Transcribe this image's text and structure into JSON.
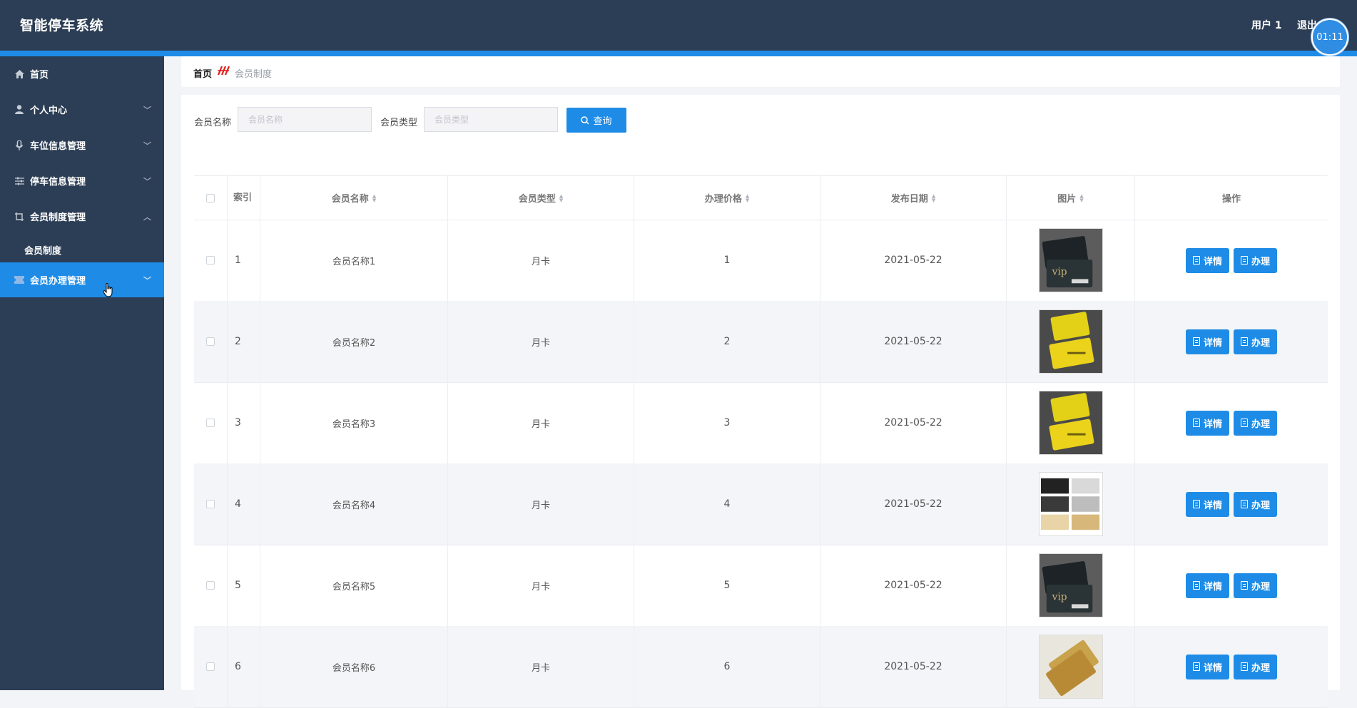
{
  "header": {
    "app_title": "智能停车系统",
    "user_label": "用户 1",
    "logout_label": "退出",
    "timer": "01:11"
  },
  "sidebar": {
    "items": [
      {
        "label": "首页",
        "icon": "home-icon"
      },
      {
        "label": "个人中心",
        "icon": "user-icon"
      },
      {
        "label": "车位信息管理",
        "icon": "microphone-icon"
      },
      {
        "label": "停车信息管理",
        "icon": "sliders-icon"
      },
      {
        "label": "会员制度管理",
        "icon": "crop-icon"
      },
      {
        "label": "会员制度",
        "sub": true
      },
      {
        "label": "会员办理管理",
        "icon": "ticket-icon",
        "active": true
      }
    ]
  },
  "breadcrumb": {
    "home": "首页",
    "current": "会员制度"
  },
  "search": {
    "name_label": "会员名称",
    "name_placeholder": "会员名称",
    "type_label": "会员类型",
    "type_placeholder": "会员类型",
    "button": "查询"
  },
  "table": {
    "headers": {
      "index": "索引",
      "name": "会员名称",
      "type": "会员类型",
      "price": "办理价格",
      "date": "发布日期",
      "image": "图片",
      "actions": "操作"
    },
    "detail_label": "详情",
    "apply_label": "办理",
    "rows": [
      {
        "index": "1",
        "name": "会员名称1",
        "type": "月卡",
        "price": "1",
        "date": "2021-05-22",
        "image": "vip-card-dark"
      },
      {
        "index": "2",
        "name": "会员名称2",
        "type": "月卡",
        "price": "2",
        "date": "2021-05-22",
        "image": "vip-card-gold"
      },
      {
        "index": "3",
        "name": "会员名称3",
        "type": "月卡",
        "price": "3",
        "date": "2021-05-22",
        "image": "vip-card-gold"
      },
      {
        "index": "4",
        "name": "会员名称4",
        "type": "月卡",
        "price": "4",
        "date": "2021-05-22",
        "image": "card-collage"
      },
      {
        "index": "5",
        "name": "会员名称5",
        "type": "月卡",
        "price": "5",
        "date": "2021-05-22",
        "image": "vip-card-dark"
      },
      {
        "index": "6",
        "name": "会员名称6",
        "type": "月卡",
        "price": "6",
        "date": "2021-05-22",
        "image": "card-gold-light"
      }
    ]
  },
  "colors": {
    "nav_bg": "#2c3e55",
    "accent": "#1e8ce6",
    "stripe": "#f4f5f8"
  }
}
